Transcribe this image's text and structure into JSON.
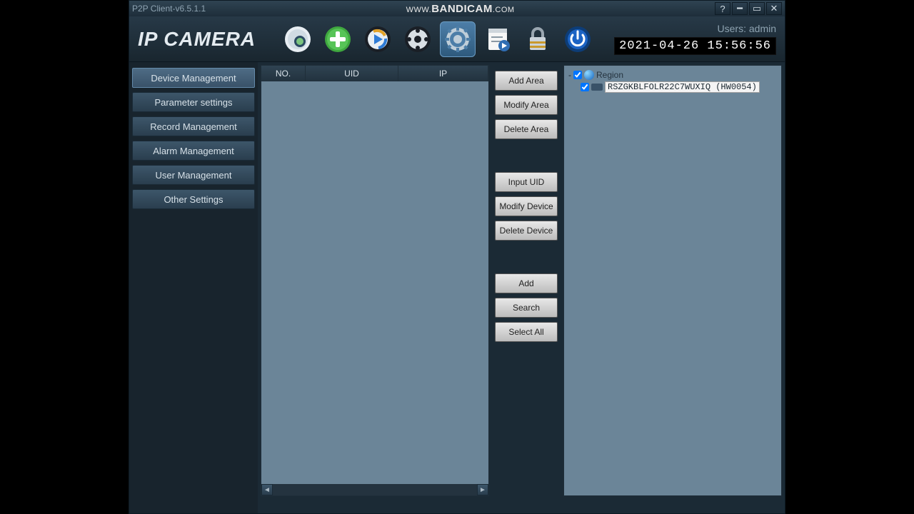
{
  "titlebar": {
    "title": "P2P Client-v6.5.1.1"
  },
  "watermark": {
    "prefix": "WWW.",
    "brand": "BANDICAM",
    "suffix": ".COM"
  },
  "header": {
    "logo": "IP CAMERA",
    "users_label": "Users: admin",
    "datetime": "2021-04-26 15:56:56"
  },
  "sidebar": {
    "items": [
      "Device Management",
      "Parameter settings",
      "Record Management",
      "Alarm Management",
      "User Management",
      "Other Settings"
    ]
  },
  "list": {
    "columns": {
      "no": "NO.",
      "uid": "UID",
      "ip": "IP"
    }
  },
  "actions": {
    "add_area": "Add Area",
    "modify_area": "Modify Area",
    "delete_area": "Delete Area",
    "input_uid": "Input UID",
    "modify_device": "Modify Device",
    "delete_device": "Delete Device",
    "add": "Add",
    "search": "Search",
    "select_all": "Select All"
  },
  "tree": {
    "root": "Region",
    "device": "RSZGKBLFOLR22C7WUXIQ (HW0054)"
  }
}
